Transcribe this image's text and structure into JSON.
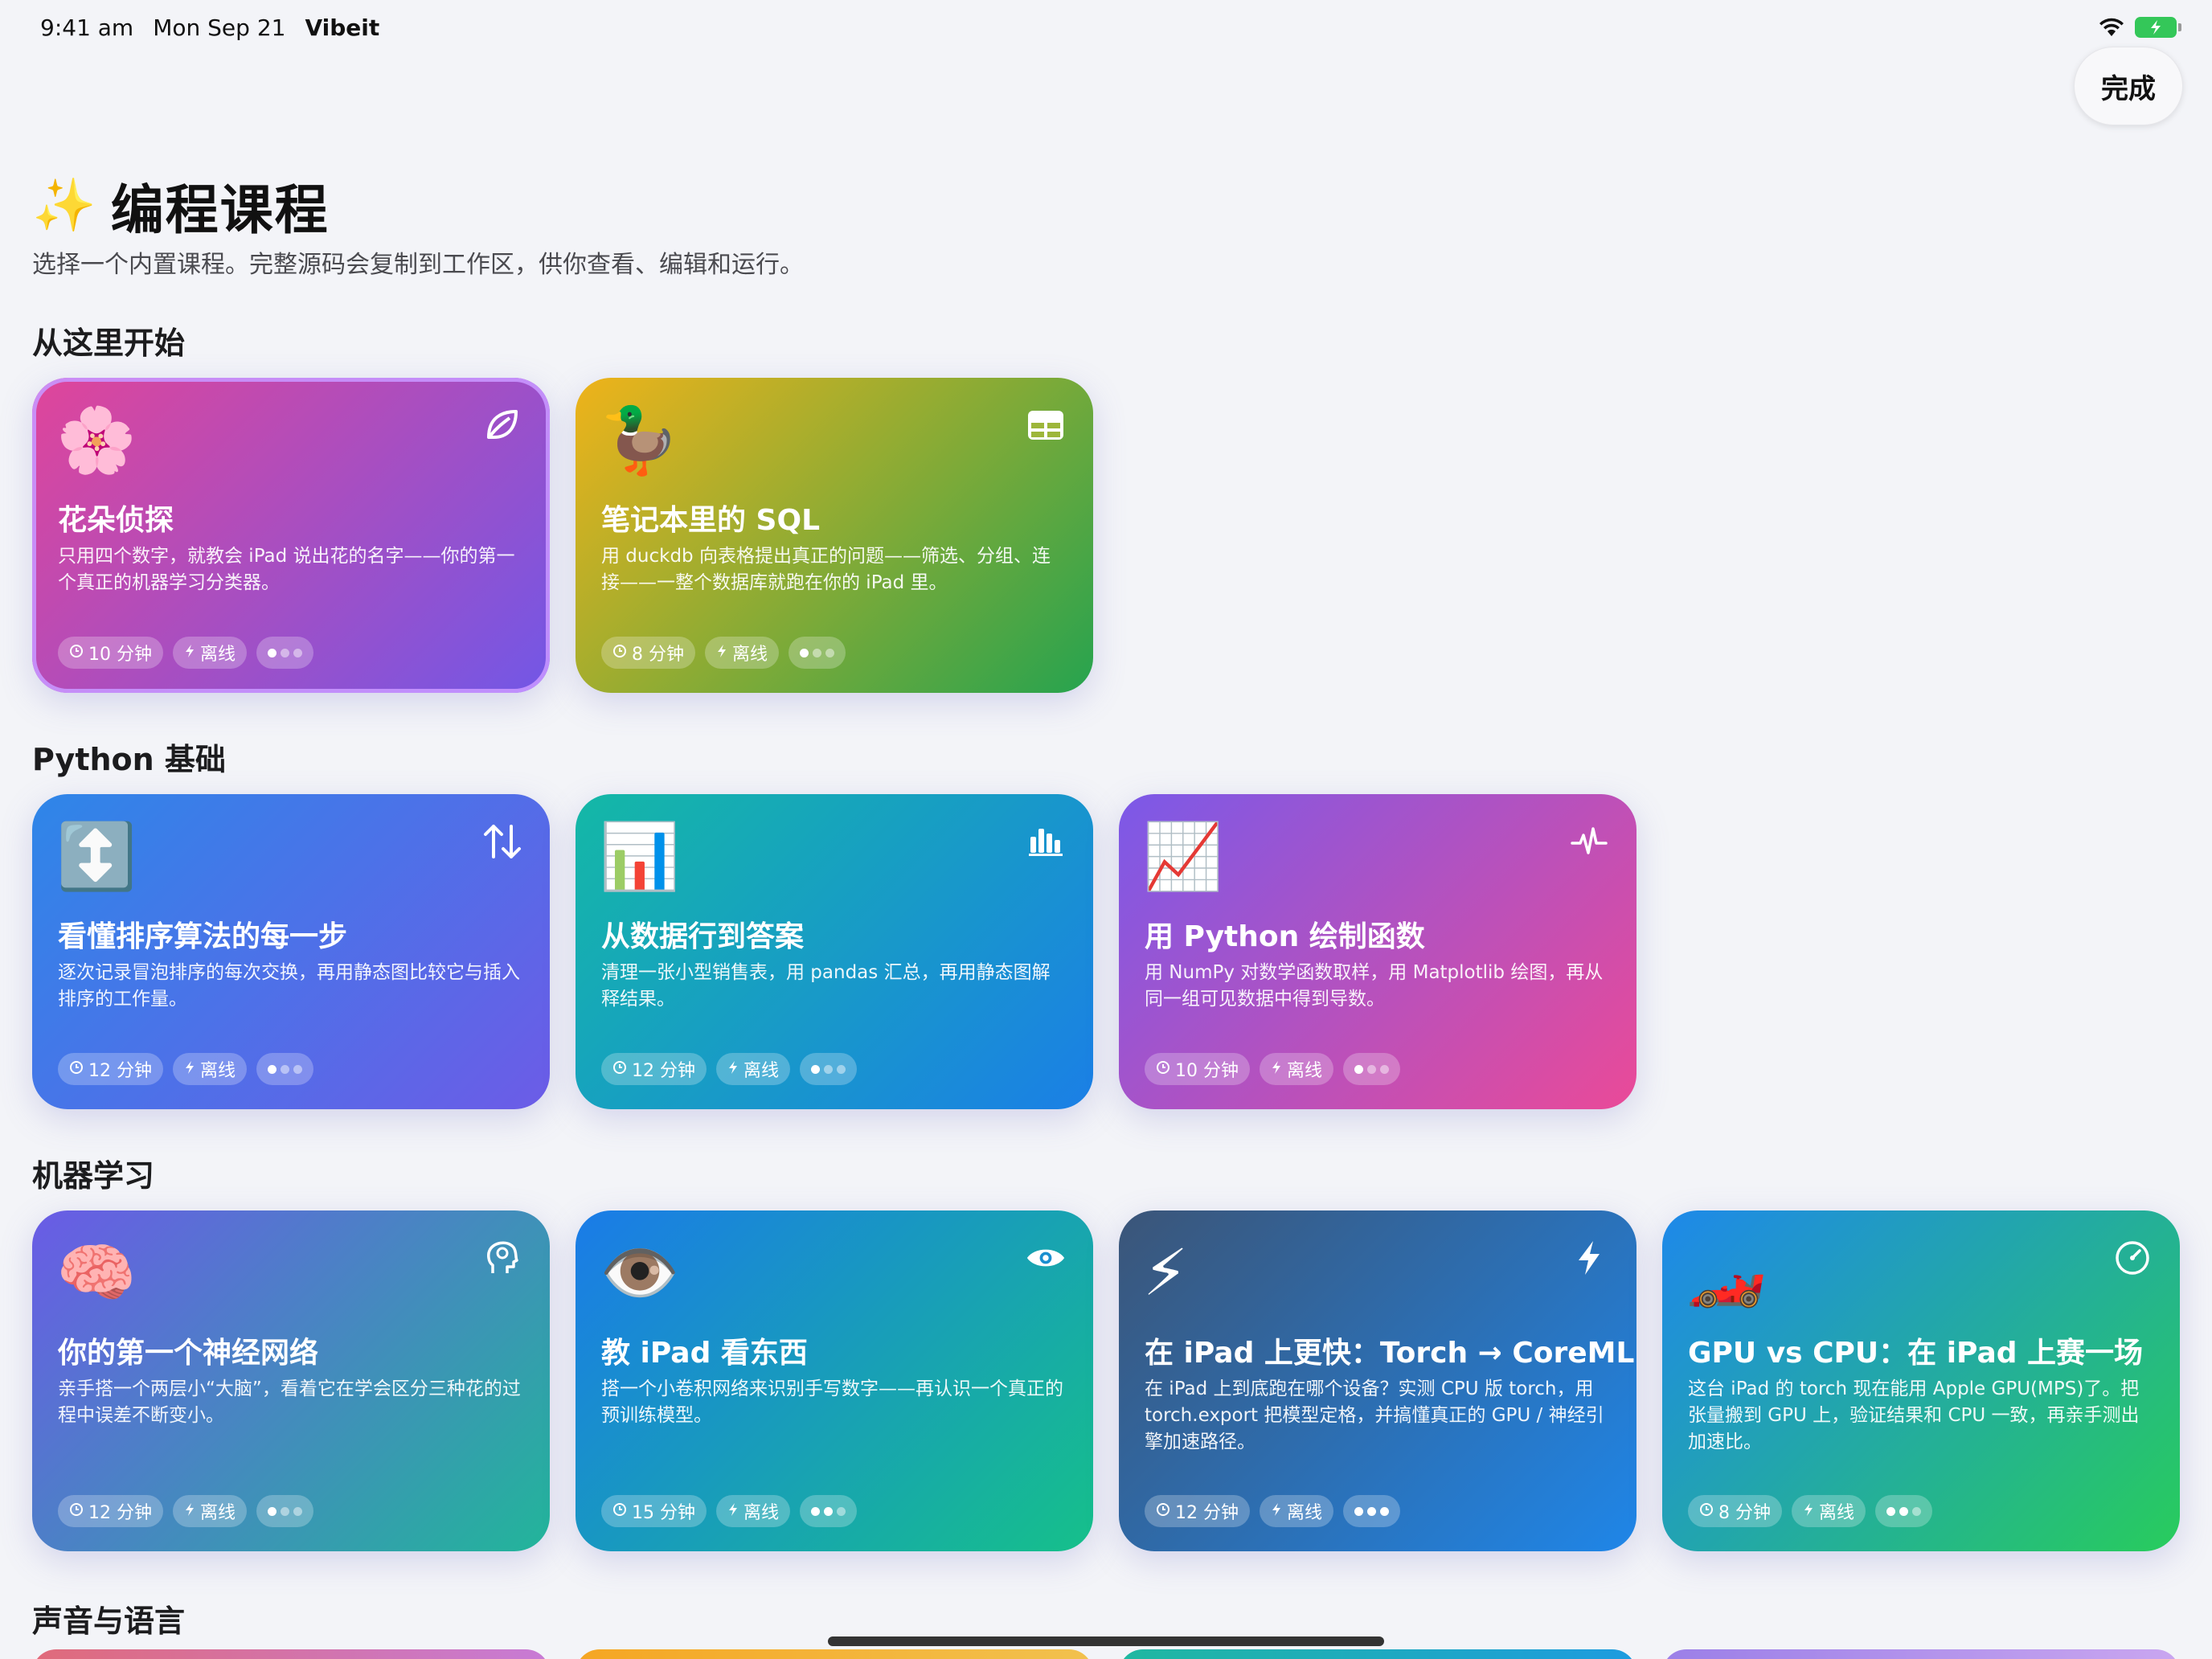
{
  "status_bar": {
    "time": "9:41 am",
    "date": "Mon Sep 21",
    "app": "Vibeit"
  },
  "header": {
    "done_label": "完成",
    "title": "编程课程",
    "sparkle": "✨",
    "subtitle": "选择一个内置课程。完整源码会复制到工作区，供你查看、编辑和运行。"
  },
  "sections": [
    {
      "title": "从这里开始",
      "cards": [
        {
          "emoji": "🌸",
          "icon": "leaf-icon",
          "title": "花朵侦探",
          "desc": "只用四个数字，就教会 iPad 说出花的名字——你的第一个真正的机器学习分类器。",
          "time": "10 分钟",
          "mode": "离线",
          "level": 1,
          "colors": [
            "#e0459a",
            "#7257e6"
          ]
        },
        {
          "emoji": "🦆",
          "icon": "table-icon",
          "title": "笔记本里的 SQL",
          "desc": "用 duckdb 向表格提出真正的问题——筛选、分组、连接——一整个数据库就跑在你的 iPad 里。",
          "time": "8 分钟",
          "mode": "离线",
          "level": 1,
          "colors": [
            "#efb31a",
            "#26a34f"
          ]
        }
      ]
    },
    {
      "title": "Python 基础",
      "cards": [
        {
          "emoji": "↕️",
          "icon": "sort-arrows-icon",
          "title": "看懂排序算法的每一步",
          "desc": "逐次记录冒泡排序的每次交换，再用静态图比较它与插入排序的工作量。",
          "time": "12 分钟",
          "mode": "离线",
          "level": 1,
          "colors": [
            "#2e86e8",
            "#6c5ce7"
          ]
        },
        {
          "emoji": "📊",
          "icon": "bar-chart-icon",
          "title": "从数据行到答案",
          "desc": "清理一张小型销售表，用 pandas 汇总，再用静态图解释结果。",
          "time": "12 分钟",
          "mode": "离线",
          "level": 1,
          "colors": [
            "#14b8a6",
            "#1b7fe6"
          ]
        },
        {
          "emoji": "📈",
          "icon": "waveform-icon",
          "title": "用 Python 绘制函数",
          "desc": "用 NumPy 对数学函数取样，用 Matplotlib 绘图，再从同一组可见数据中得到导数。",
          "time": "10 分钟",
          "mode": "离线",
          "level": 1,
          "colors": [
            "#7b59e8",
            "#ea4a98"
          ]
        }
      ]
    },
    {
      "title": "机器学习",
      "cards": [
        {
          "emoji": "🧠",
          "icon": "brain-head-icon",
          "title": "你的第一个神经网络",
          "desc": "亲手搭一个两层小“大脑”，看着它在学会区分三种花的过程中误差不断变小。",
          "time": "12 分钟",
          "mode": "离线",
          "level": 1,
          "colors": [
            "#6a5be6",
            "#22b59a"
          ]
        },
        {
          "emoji": "👁️",
          "icon": "eye-icon",
          "title": "教 iPad 看东西",
          "desc": "搭一个小卷积网络来识别手写数字——再认识一个真正的预训练模型。",
          "time": "15 分钟",
          "mode": "离线",
          "level": 2,
          "colors": [
            "#1a7be8",
            "#16c08a"
          ]
        },
        {
          "emoji": "⚡",
          "icon": "bolt-icon",
          "title": "在 iPad 上更快：Torch → CoreML",
          "desc": "在 iPad 上到底跑在哪个设备？实测 CPU 版 torch，用 torch.export 把模型定格，并搞懂真正的 GPU / 神经引擎加速路径。",
          "time": "12 分钟",
          "mode": "离线",
          "level": 3,
          "colors": [
            "#3b5578",
            "#1f86e8"
          ]
        },
        {
          "emoji": "🏎️",
          "icon": "speedometer-icon",
          "title": "GPU vs CPU：在 iPad 上赛一场",
          "desc": "这台 iPad 的 torch 现在能用 Apple GPU(MPS)了。把张量搬到 GPU 上，验证结果和 CPU 一致，再亲手测出加速比。",
          "time": "8 分钟",
          "mode": "离线",
          "level": 2,
          "colors": [
            "#1e88ea",
            "#28cc5c"
          ]
        }
      ]
    },
    {
      "title": "声音与语言",
      "cards": []
    }
  ]
}
